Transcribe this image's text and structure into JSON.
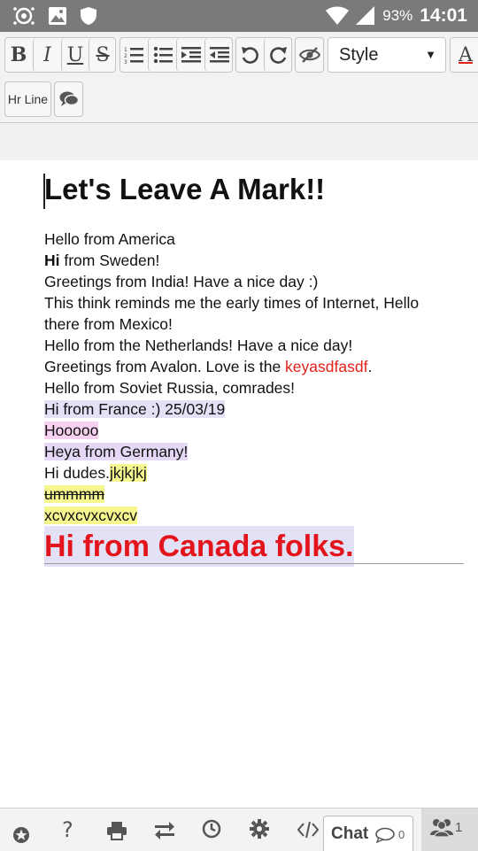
{
  "status_bar": {
    "battery": "93%",
    "time": "14:01"
  },
  "toolbar": {
    "bold": "B",
    "italic": "I",
    "underline": "U",
    "strike": "S",
    "font_color": "A",
    "style_select": "Style",
    "hr_line": "Hr Line"
  },
  "document": {
    "heading": "Let's Leave A Mark!!",
    "lines": [
      {
        "text": "Hello from America"
      },
      {
        "bold_part": "Hi",
        "text": " from Sweden!"
      },
      {
        "text": "Greetings from India! Have a nice day :)"
      },
      {
        "text": "This think reminds me the early times of Internet, Hello"
      },
      {
        "text": "there from Mexico!"
      },
      {
        "text": "Hello from the Netherlands! Have a nice day!"
      },
      {
        "text": "Greetings from Avalon. Love is the ",
        "red_part": "keyasdfasdf",
        "tail": "."
      },
      {
        "text": "Hello from Soviet Russia, comrades!"
      },
      {
        "text": "Hi from France :) 25/03/19"
      },
      {
        "text": "Hooooo"
      },
      {
        "text": "Heya from Germany!"
      },
      {
        "text": "Hi dudes.",
        "highlight_part": "jkjkjkj"
      },
      {
        "text": "ummmm"
      },
      {
        "text": "xcvxcvxcvxcv"
      }
    ],
    "big_line": "Hi from Canada folks."
  },
  "bottom_bar": {
    "chat_label": "Chat",
    "chat_count": "0",
    "users_count": "1"
  }
}
